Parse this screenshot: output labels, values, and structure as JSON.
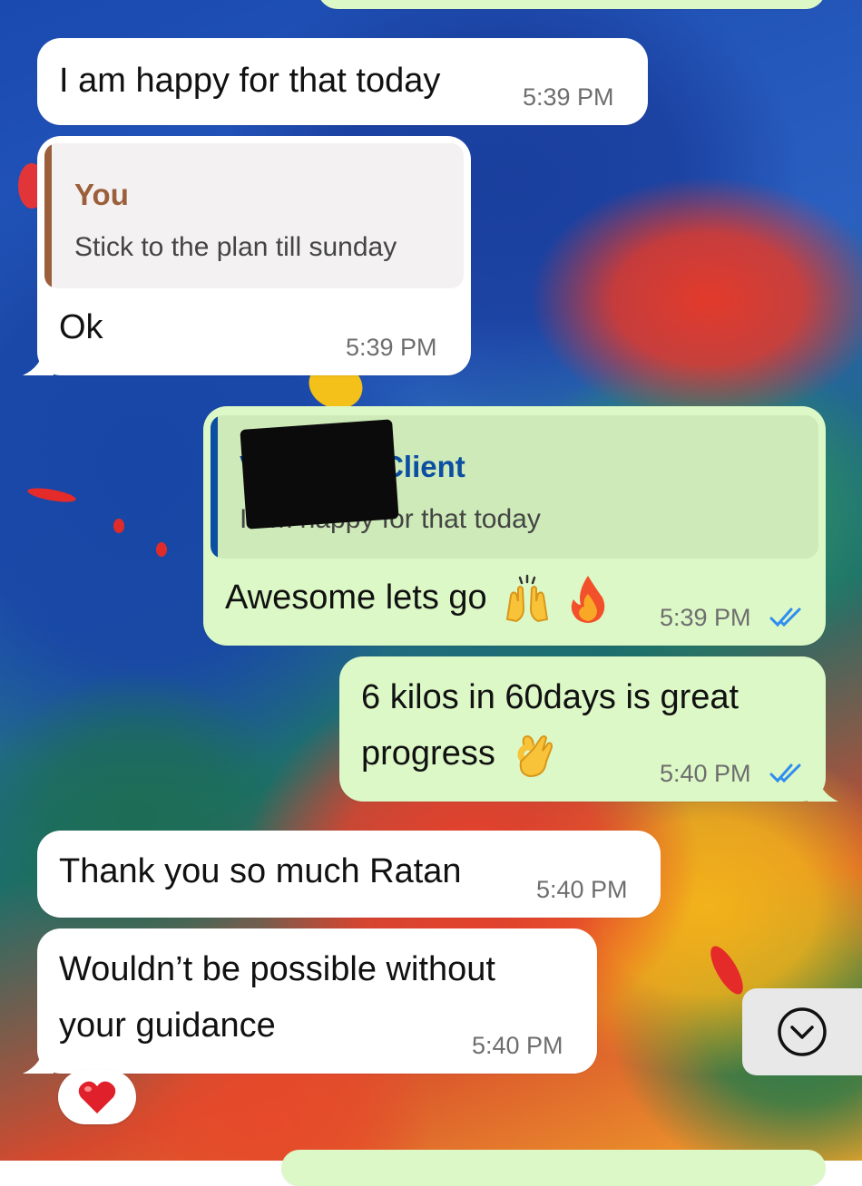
{
  "messages": [
    {
      "id": "m1",
      "direction": "incoming",
      "text": "I am happy for that today",
      "time": "5:39 PM"
    },
    {
      "id": "m2",
      "direction": "incoming",
      "quote": {
        "name": "You",
        "text": "Stick to the plan till sunday"
      },
      "text": "Ok",
      "time": "5:39 PM"
    },
    {
      "id": "m3",
      "direction": "outgoing",
      "quote": {
        "name": "Vignesh - Client",
        "text": "I am happy for that today"
      },
      "text": "Awesome lets go",
      "emojis": [
        "raising-hands-icon",
        "fire-icon"
      ],
      "time": "5:39 PM",
      "status": "read"
    },
    {
      "id": "m4",
      "direction": "outgoing",
      "text_lines": [
        "6 kilos in 60days is great",
        "progress"
      ],
      "emojis": [
        "ok-hand-icon"
      ],
      "time": "5:40 PM",
      "status": "read"
    },
    {
      "id": "m5",
      "direction": "incoming",
      "text": "Thank you so much Ratan",
      "time": "5:40 PM"
    },
    {
      "id": "m6",
      "direction": "incoming",
      "text_lines": [
        "Wouldn’t be possible without",
        "your guidance"
      ],
      "time": "5:40 PM",
      "reaction": "heart-icon"
    }
  ],
  "colors": {
    "incoming_bubble": "#ffffff",
    "outgoing_bubble": "#dcf8c6",
    "quote_you_accent": "#9b5f3c",
    "quote_client_accent": "#0b4ea2",
    "read_tick": "#2f8cf0",
    "timestamp": "#6e6e6e"
  },
  "scroll_to_bottom": {
    "icon": "chevron-down-icon"
  }
}
